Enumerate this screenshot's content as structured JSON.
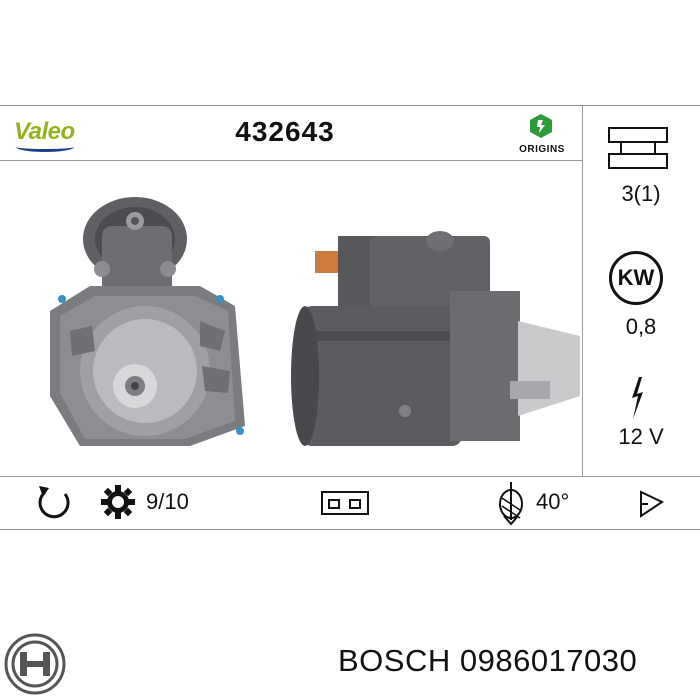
{
  "header": {
    "brand": "Valeo",
    "part_number": "432643",
    "origins_label": "ORIGINS"
  },
  "specs": {
    "mounting": "3(1)",
    "power_unit": "KW",
    "power_value": "0,8",
    "voltage": "12 V"
  },
  "bottom_row": {
    "teeth": "9/10",
    "angle": "40°"
  },
  "footer": {
    "text": "BOSCH 0986017030"
  },
  "colors": {
    "valeo_green": "#95b21b",
    "valeo_blue": "#1e3f8a",
    "origins_green": "#2e9b3a"
  },
  "icons": [
    "valeo-logo",
    "origins-icon",
    "mounting-flange-icon",
    "kw-badge-icon",
    "lightning-icon",
    "rotation-icon",
    "gear-icon",
    "terminal-connector-icon",
    "pinion-angle-icon",
    "pinion-cone-icon",
    "bosch-logo"
  ]
}
